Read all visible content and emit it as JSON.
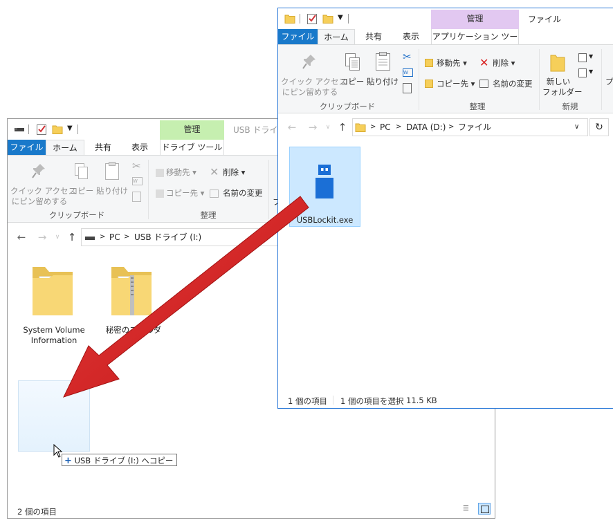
{
  "colors": {
    "file_tab": "#1979ca",
    "manage_usb": "#c6efb0",
    "manage_data": "#e2c8f1",
    "selection": "#cce8ff",
    "arrow": "#d92323"
  },
  "usb_window": {
    "title": "USB ドライブ (",
    "context_header": "管理",
    "tabs": {
      "file": "ファイル",
      "home": "ホーム",
      "share": "共有",
      "view": "表示",
      "tools": "ドライブ ツール"
    },
    "ribbon": {
      "quick_access_line1": "クイック アクセス",
      "quick_access_line2": "にピン留めする",
      "copy": "コピー",
      "paste": "貼り付け",
      "move_to": "移動先",
      "delete": "削除",
      "copy_to": "コピー先",
      "rename": "名前の変更",
      "group_clipboard": "クリップボード",
      "group_organize": "整理",
      "cut_off": "フ"
    },
    "address": {
      "pc": "PC",
      "drive": "USB ドライブ (I:)"
    },
    "items": [
      {
        "line1": "System Volume",
        "line2": "Information"
      },
      {
        "line1": "秘密のフォルダ",
        "line2": ""
      }
    ],
    "drag_tooltip": "USB ドライブ (I:) へコピー",
    "status": "2 個の項目"
  },
  "data_window": {
    "context_header": "管理",
    "context_title": "ファイル",
    "tabs": {
      "file": "ファイル",
      "home": "ホーム",
      "share": "共有",
      "view": "表示",
      "tools": "アプリケーション ツール"
    },
    "ribbon": {
      "quick_access_line1": "クイック アクセス",
      "quick_access_line2": "にピン留めする",
      "copy": "コピー",
      "paste": "貼り付け",
      "move_to": "移動先",
      "delete": "削除",
      "copy_to": "コピー先",
      "rename": "名前の変更",
      "new_folder_line1": "新しい",
      "new_folder_line2": "フォルダー",
      "group_clipboard": "クリップボード",
      "group_organize": "整理",
      "group_new": "新規",
      "cut_off": "プ"
    },
    "address": {
      "pc": "PC",
      "drive": "DATA (D:)",
      "folder": "ファイル"
    },
    "file": {
      "name": "USBLockit.exe"
    },
    "status": {
      "count": "1 個の項目",
      "selected": "1 個の項目を選択",
      "size": "11.5 KB"
    }
  }
}
